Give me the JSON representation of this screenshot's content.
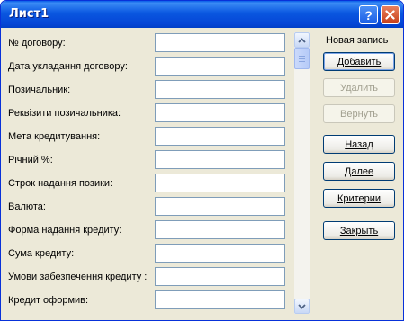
{
  "window": {
    "title": "Лист1",
    "help_icon": "question-icon",
    "close_icon": "close-icon"
  },
  "form": {
    "labels": [
      "№ договору:",
      "Дата укладання договору:",
      "Позичальник:",
      "Реквізити позичальника:",
      "Мета кредитування:",
      "Річний %:",
      "Строк надання позики:",
      "Валюта:",
      "Форма надання кредиту:",
      "Сума кредиту:",
      "Умови забезпечення кредиту :",
      "Кредит оформив:"
    ],
    "values": [
      "",
      "",
      "",
      "",
      "",
      "",
      "",
      "",
      "",
      "",
      "",
      ""
    ]
  },
  "side": {
    "caption": "Новая запись",
    "add": "Добавить",
    "delete": "Удалить",
    "restore": "Вернуть",
    "back": "Назад",
    "next": "Далее",
    "criteria": "Критерии",
    "close": "Закрыть"
  },
  "scroll": {
    "up_icon": "up-arrow-icon",
    "down_icon": "down-arrow-icon"
  }
}
